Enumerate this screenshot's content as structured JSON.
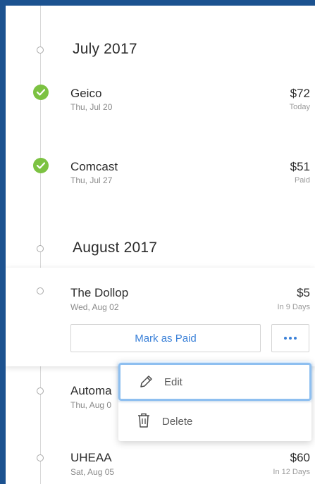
{
  "months": [
    {
      "label": "July 2017"
    },
    {
      "label": "August 2017"
    }
  ],
  "bills": [
    {
      "name": "Geico",
      "date": "Thu, Jul 20",
      "amount": "$72",
      "status": "Today",
      "paid": true
    },
    {
      "name": "Comcast",
      "date": "Thu, Jul 27",
      "amount": "$51",
      "status": "Paid",
      "paid": true
    },
    {
      "name": "The Dollop",
      "date": "Wed, Aug 02",
      "amount": "$5",
      "status": "In 9 Days",
      "paid": false
    },
    {
      "name": "Automa",
      "date": "Thu, Aug 0",
      "amount": "",
      "status": "",
      "paid": false
    },
    {
      "name": "UHEAA",
      "date": "Sat, Aug 05",
      "amount": "$60",
      "status": "In 12 Days",
      "paid": false
    }
  ],
  "actions": {
    "mark_paid_label": "Mark as Paid"
  },
  "context_menu": {
    "items": [
      {
        "label": "Edit",
        "icon": "pencil-icon"
      },
      {
        "label": "Delete",
        "icon": "trash-icon"
      }
    ]
  },
  "colors": {
    "accent": "#3a80d8",
    "paid_check": "#7cc242",
    "frame_border": "#1c5290",
    "focus_ring": "#8ebff0"
  }
}
